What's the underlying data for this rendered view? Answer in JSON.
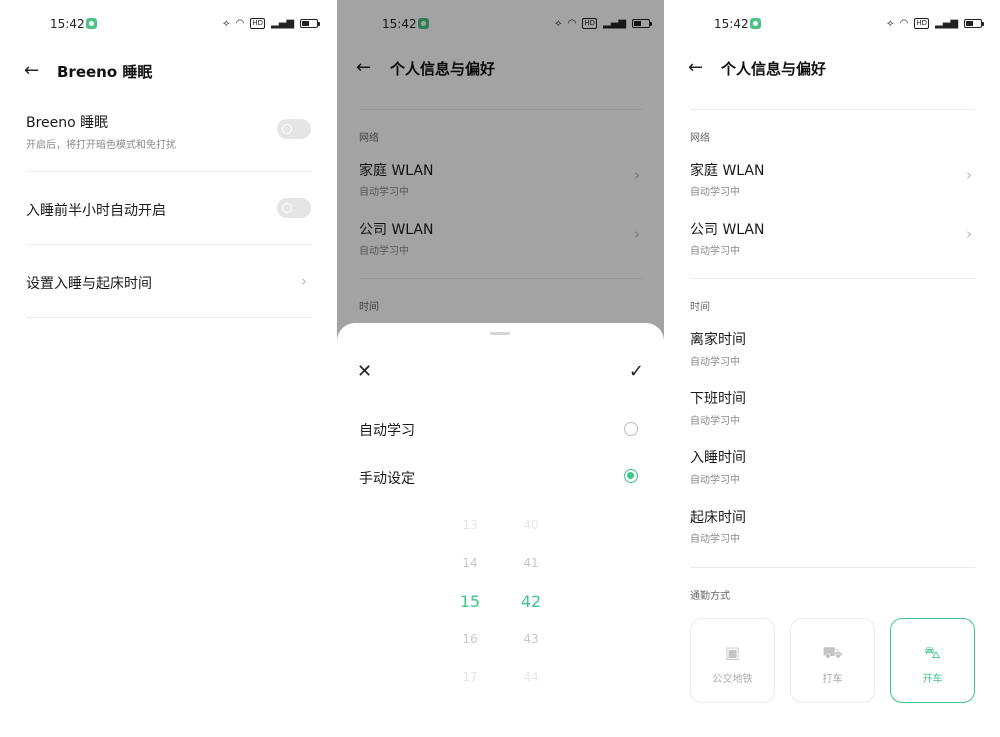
{
  "status": {
    "time": "15:42",
    "hd": "HD",
    "signal": "⁵ᴳ"
  },
  "screen1": {
    "title": "Breeno 睡眠",
    "rows": [
      {
        "title": "Breeno 睡眠",
        "subtitle": "开启后，将打开暗色模式和免打扰"
      },
      {
        "title": "入睡前半小时自动开启"
      },
      {
        "title": "设置入睡与起床时间"
      }
    ]
  },
  "screen2": {
    "title": "个人信息与偏好",
    "section_network": "网络",
    "items": [
      {
        "title": "家庭 WLAN",
        "subtitle": "自动学习中"
      },
      {
        "title": "公司 WLAN",
        "subtitle": "自动学习中"
      }
    ],
    "section_time": "时间",
    "sheet": {
      "options": [
        "自动学习",
        "手动设定"
      ],
      "selected_option": 1,
      "hours": [
        "13",
        "14",
        "15",
        "16",
        "17"
      ],
      "minutes": [
        "40",
        "41",
        "42",
        "43",
        "44"
      ]
    }
  },
  "screen3": {
    "title": "个人信息与偏好",
    "section_network": "网络",
    "network_items": [
      {
        "title": "家庭 WLAN",
        "subtitle": "自动学习中"
      },
      {
        "title": "公司 WLAN",
        "subtitle": "自动学习中"
      }
    ],
    "section_time": "时间",
    "time_items": [
      {
        "title": "离家时间",
        "subtitle": "自动学习中"
      },
      {
        "title": "下班时间",
        "subtitle": "自动学习中"
      },
      {
        "title": "入睡时间",
        "subtitle": "自动学习中"
      },
      {
        "title": "起床时间",
        "subtitle": "自动学习中"
      }
    ],
    "section_commute": "通勤方式",
    "commute": [
      {
        "label": "公交地铁",
        "icon": "bus-icon"
      },
      {
        "label": "打车",
        "icon": "taxi-icon"
      },
      {
        "label": "开车",
        "icon": "car-icon"
      }
    ],
    "selected_commute": "开车"
  },
  "colors": {
    "accent": "#3ec58a",
    "call": "#4cc28a"
  }
}
